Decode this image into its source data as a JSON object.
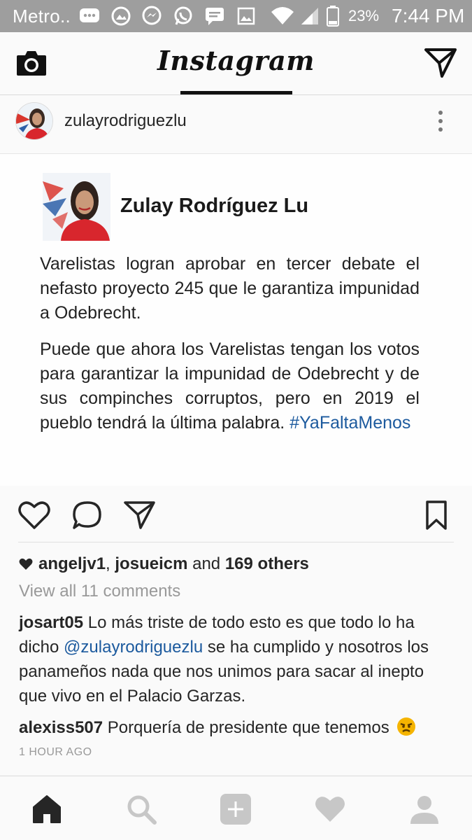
{
  "status_bar": {
    "carrier": "Metro..",
    "battery_percent": "23%",
    "time": "7:44 PM",
    "notification_icons": [
      "chat-icon",
      "photo-icon",
      "messenger-icon",
      "whatsapp-icon",
      "sms-icon",
      "gallery-icon"
    ],
    "system_icons": [
      "wifi-icon",
      "signal-icon",
      "battery-icon"
    ]
  },
  "header": {
    "title": "Instagram"
  },
  "post": {
    "username": "zulayrodriguezlu",
    "image": {
      "author_name": "Zulay Rodríguez Lu",
      "paragraph1": "Varelistas logran aprobar en tercer debate el nefasto proyecto 245 que le garantiza impunidad  a Odebrecht.",
      "paragraph2_text": "Puede que ahora los Varelistas tengan los votos para garantizar la impunidad de Odebrecht y de sus compinches corruptos, pero en 2019 el pueblo tendrá la última palabra.",
      "hashtag": "#YaFaltaMenos"
    },
    "likes": {
      "user1": "angeljv1",
      "separator": ",",
      "user2": "josueicm",
      "connector": "and",
      "others": "169 others"
    },
    "view_all": "View all 11 comments",
    "comments": [
      {
        "user": "josart05",
        "text_before": "Lo más triste de todo esto es que todo lo ha dicho",
        "mention": "@zulayrodriguezlu",
        "text_after": "se ha cumplido y nosotros los panameños nada que nos unimos para sacar al inepto que vivo en el Palacio Garzas."
      },
      {
        "user": "alexiss507",
        "text": "Porquería de presidente que tenemos",
        "emoji": "angry-face-icon"
      }
    ],
    "timestamp": "1 HOUR AGO"
  },
  "colors": {
    "status_bar": "#9e9e9e",
    "link": "#1c5a9e",
    "muted": "#999999",
    "text": "#262626"
  }
}
